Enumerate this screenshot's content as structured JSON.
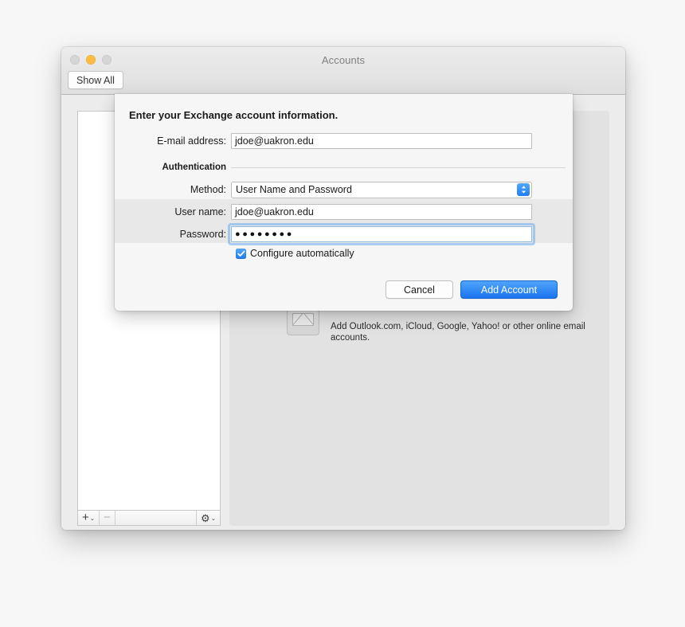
{
  "window": {
    "title": "Accounts",
    "traffic_lights": [
      {
        "name": "close",
        "color": "#d5d5d5",
        "active": false
      },
      {
        "name": "minimize",
        "color": "#fcbc40",
        "active": true
      },
      {
        "name": "zoom",
        "color": "#d5d5d5",
        "active": false
      }
    ],
    "toolbar": {
      "show_all_label": "Show All"
    }
  },
  "sidebar": {
    "accounts": [],
    "toolbar": {
      "add_label": "+",
      "add_chevron": "⌄",
      "remove_label": "−",
      "action_label": "⚙",
      "action_chevron": "⌄"
    }
  },
  "content_panel": {
    "icon": "mail-envelope-icon",
    "description": "Add Outlook.com, iCloud, Google, Yahoo! or other online email accounts."
  },
  "sheet": {
    "title": "Enter your Exchange account information.",
    "fields": {
      "email": {
        "label": "E-mail address:",
        "value": "jdoe@uakron.edu",
        "placeholder": ""
      },
      "method": {
        "label": "Method:",
        "value": "User Name and Password",
        "options": [
          "User Name and Password"
        ]
      },
      "username": {
        "label": "User name:",
        "value": "jdoe@uakron.edu",
        "placeholder": ""
      },
      "password": {
        "label": "Password:",
        "value": "●●●●●●●●",
        "placeholder": "",
        "focused": true
      }
    },
    "group_header": "Authentication",
    "checkbox": {
      "label": "Configure automatically",
      "checked": true
    },
    "buttons": {
      "cancel": "Cancel",
      "add_account": "Add Account"
    }
  },
  "colors": {
    "accent_blue": "#1b74ef",
    "amber": "#fcbc40",
    "focus_ring": "#68aaee",
    "window_bg": "#ececec",
    "sheet_bg": "#f6f6f6"
  }
}
